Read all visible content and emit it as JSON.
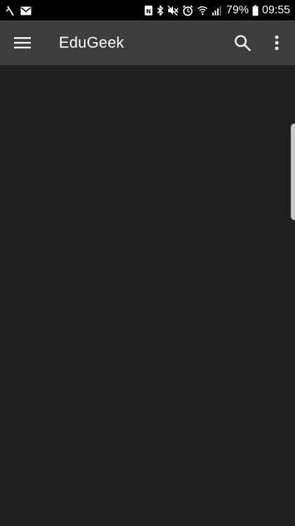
{
  "status_bar": {
    "icons_left": [
      "signal-no-data-icon",
      "email-icon"
    ],
    "icons_right": [
      "nfc-icon",
      "bluetooth-icon",
      "mute-icon",
      "alarm-icon",
      "wifi-icon",
      "cellular-signal-icon",
      "battery-icon"
    ],
    "battery_percent": "79%",
    "time": "09:55"
  },
  "app_bar": {
    "title": "EduGeek",
    "icons": [
      "menu-icon",
      "search-icon",
      "more-vertical-icon"
    ]
  },
  "colors": {
    "status_bar_bg": "#000000",
    "app_bar_bg": "#3d3d3d",
    "content_bg": "#1f2022",
    "text": "#ffffff",
    "edge_handle": "#c8c8c8"
  }
}
